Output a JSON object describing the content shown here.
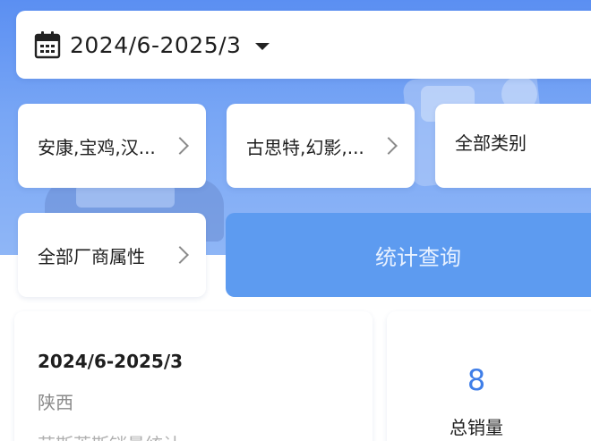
{
  "date_range": {
    "value": "2024/6-2025/3"
  },
  "filters": {
    "region": "安康,宝鸡,汉...",
    "model": "古思特,幻影,...",
    "category": "全部类别",
    "manufacturer_attr": "全部厂商属性"
  },
  "query_button": {
    "label": "统计查询"
  },
  "result": {
    "date": "2024/6-2025/3",
    "region": "陕西",
    "stat_title": "劳斯莱斯销量统计"
  },
  "total": {
    "value": "8",
    "label": "总销量"
  },
  "colors": {
    "accent": "#5d9bf0",
    "total_number": "#3f7ee8",
    "hero_bg": "#6f9ff3"
  },
  "icons": {
    "date": "calendar-icon",
    "dropdown": "caret-down-icon",
    "filter_arrow": "chevron-right-icon"
  }
}
